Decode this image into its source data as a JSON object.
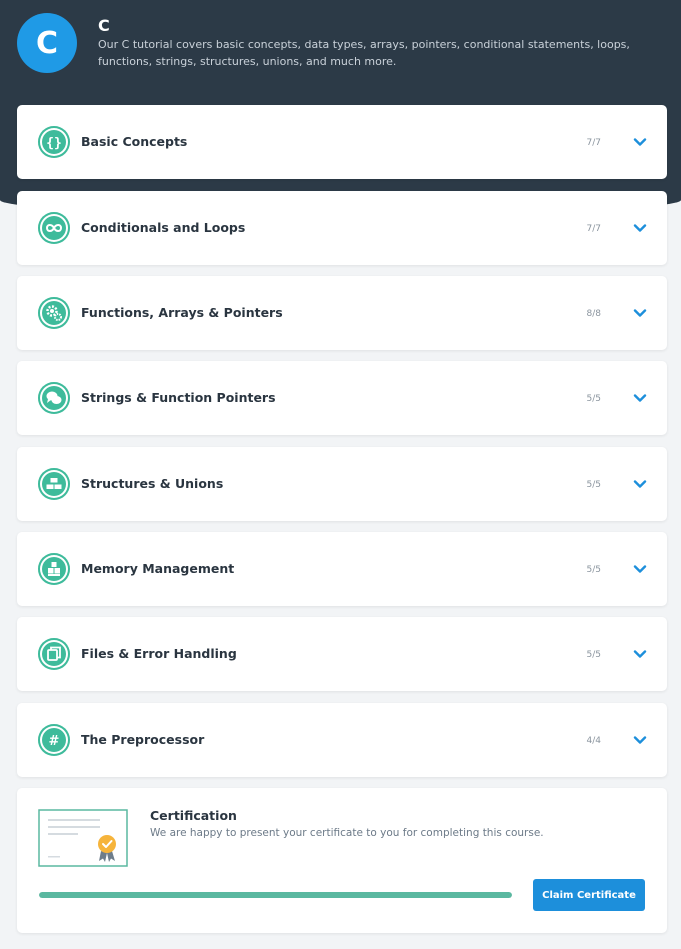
{
  "course": {
    "logo_letter": "C",
    "title": "C",
    "description": "Our C tutorial covers basic concepts, data types, arrays, pointers, conditional statements, loops, functions, strings, structures, unions, and much more."
  },
  "modules": [
    {
      "title": "Basic Concepts",
      "progress": "7/7",
      "icon": "braces-icon"
    },
    {
      "title": "Conditionals and Loops",
      "progress": "7/7",
      "icon": "infinity-icon"
    },
    {
      "title": "Functions, Arrays & Pointers",
      "progress": "8/8",
      "icon": "gears-icon"
    },
    {
      "title": "Strings & Function Pointers",
      "progress": "5/5",
      "icon": "speech-bubbles-icon"
    },
    {
      "title": "Structures & Unions",
      "progress": "5/5",
      "icon": "structure-blocks-icon"
    },
    {
      "title": "Memory Management",
      "progress": "5/5",
      "icon": "stacked-blocks-icon"
    },
    {
      "title": "Files & Error Handling",
      "progress": "5/5",
      "icon": "files-icon"
    },
    {
      "title": "The Preprocessor",
      "progress": "4/4",
      "icon": "hash-icon"
    }
  ],
  "certification": {
    "title": "Certification",
    "description": "We are happy to present your certificate to you for completing this course.",
    "progress_fraction": 1.0,
    "claim_label": "Claim Certificate"
  },
  "colors": {
    "header_bg": "#2c3a47",
    "logo_blue": "#1f9ae6",
    "module_icon_green": "#3ebb9b",
    "chevron_blue": "#1d8fdb",
    "progress_green": "#5ab8a0",
    "button_blue": "#1d8fdb"
  }
}
